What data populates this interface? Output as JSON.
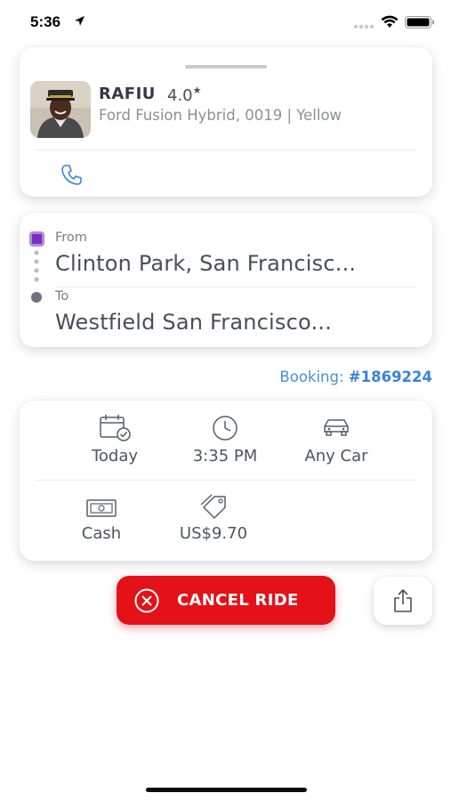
{
  "status_bar": {
    "time": "5:36"
  },
  "driver": {
    "name": "RAFIU",
    "rating": "4.0",
    "rating_star": "★",
    "vehicle": "Ford Fusion Hybrid, 0019 | Yellow"
  },
  "route": {
    "from_label": "From",
    "from_address": "Clinton Park, San Francisc...",
    "to_label": "To",
    "to_address": "Westfield San Francisco..."
  },
  "booking": {
    "label": "Booking:",
    "number": "#1869224"
  },
  "details": {
    "date": "Today",
    "time": "3:35 PM",
    "vehicle_type": "Any Car",
    "payment": "Cash",
    "price": "US$9.70"
  },
  "actions": {
    "cancel_label": "CANCEL RIDE"
  },
  "colors": {
    "accent_blue": "#3b82d6",
    "cancel_red": "#e41118",
    "from_marker_purple": "#7a2fbf"
  },
  "icons": {
    "phone": "phone-icon",
    "calendar": "calendar-check-icon",
    "clock": "clock-icon",
    "car": "car-icon",
    "cash": "cash-icon",
    "price_tag": "price-tag-icon",
    "cancel": "close-circle-icon",
    "share": "share-icon"
  }
}
